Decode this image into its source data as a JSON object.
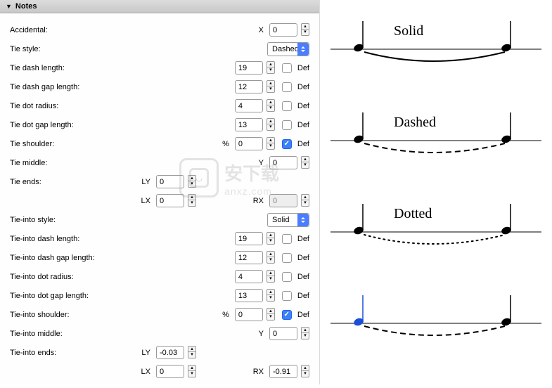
{
  "panel_title": "Notes",
  "labels": {
    "accidental": "Accidental:",
    "tie_style": "Tie style:",
    "tie_dash_length": "Tie dash length:",
    "tie_dash_gap_length": "Tie dash gap length:",
    "tie_dot_radius": "Tie dot radius:",
    "tie_dot_gap_length": "Tie dot gap length:",
    "tie_shoulder": "Tie shoulder:",
    "tie_middle": "Tie middle:",
    "tie_ends": "Tie ends:",
    "tie_into_style": "Tie-into style:",
    "tie_into_dash_length": "Tie-into dash length:",
    "tie_into_dash_gap_length": "Tie-into dash gap length:",
    "tie_into_dot_radius": "Tie-into dot radius:",
    "tie_into_dot_gap_length": "Tie-into dot gap length:",
    "tie_into_shoulder": "Tie-into shoulder:",
    "tie_into_middle": "Tie-into middle:",
    "tie_into_ends": "Tie-into ends:"
  },
  "prefixes": {
    "X": "X",
    "Y": "Y",
    "percent": "%",
    "LY": "LY",
    "LX": "LX",
    "RX": "RX"
  },
  "def_label": "Def",
  "tie_style_options": {
    "selected": "Dashed"
  },
  "tie_into_style_options": {
    "selected": "Solid"
  },
  "values": {
    "accidental_x": "0",
    "tie_dash_length": "19",
    "tie_dash_gap_length": "12",
    "tie_dot_radius": "4",
    "tie_dot_gap_length": "13",
    "tie_shoulder": "0",
    "tie_middle_y": "0",
    "tie_ends_ly": "0",
    "tie_ends_lx": "0",
    "tie_ends_rx": "0",
    "tie_into_dash_length": "19",
    "tie_into_dash_gap_length": "12",
    "tie_into_dot_radius": "4",
    "tie_into_dot_gap_length": "13",
    "tie_into_shoulder": "0",
    "tie_into_middle_y": "0",
    "tie_into_ends_ly": "-0.03",
    "tie_into_ends_lx": "0",
    "tie_into_ends_rx": "-0.91"
  },
  "def_checked": {
    "tie_dash_length": false,
    "tie_dash_gap_length": false,
    "tie_dot_radius": false,
    "tie_dot_gap_length": false,
    "tie_shoulder": true,
    "tie_into_dash_length": false,
    "tie_into_dash_gap_length": false,
    "tie_into_dot_radius": false,
    "tie_into_dot_gap_length": false,
    "tie_into_shoulder": true
  },
  "preview_labels": {
    "solid": "Solid",
    "dashed": "Dashed",
    "dotted": "Dotted"
  },
  "watermark": {
    "zh": "安下载",
    "en": "anxz.com"
  }
}
